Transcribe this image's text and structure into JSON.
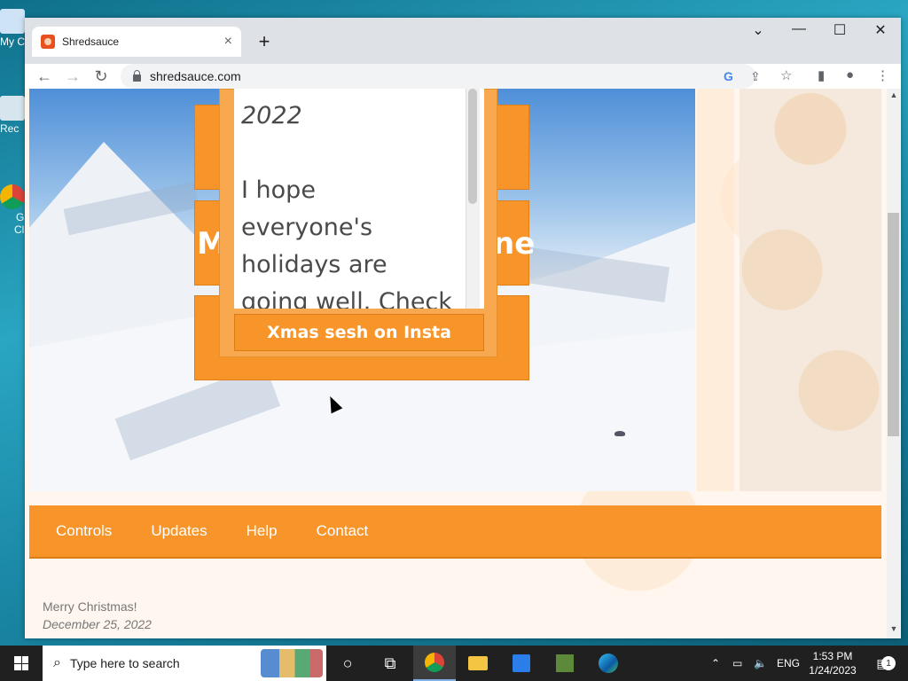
{
  "desktop": {
    "icons": [
      {
        "label": "My C"
      },
      {
        "label": "Rec"
      },
      {
        "label": "G"
      },
      {
        "label": "Cl"
      }
    ]
  },
  "browser": {
    "tab": {
      "title": "Shredsauce",
      "close": "×"
    },
    "new_tab": "+",
    "window_controls": {
      "chevron": "⌄",
      "minimize": "—",
      "maximize": "☐",
      "close": "✕"
    },
    "nav": {
      "back": "←",
      "forward": "→",
      "reload": "↻"
    },
    "url": "shredsauce.com",
    "omni_icons": {
      "google": "G",
      "share": "⇪",
      "star": "☆"
    },
    "toolbar_icons": {
      "sidepanel": "▮",
      "profile": "●",
      "menu": "⋮"
    }
  },
  "page": {
    "left_block_text": "M",
    "right_block_text": "ne",
    "popup": {
      "lines": [
        "2022",
        "",
        "I hope",
        "everyone's",
        "holidays are",
        "going well. Check"
      ],
      "button": "Xmas sesh on Insta"
    },
    "nav_links": [
      "Controls",
      "Updates",
      "Help",
      "Contact"
    ],
    "post": {
      "title": "Merry Christmas!",
      "date": "December 25, 2022"
    },
    "scroll_up": "▲",
    "scroll_down": "▼"
  },
  "taskbar": {
    "search_placeholder": "Type here to search",
    "tray": {
      "language": "ENG",
      "time": "1:53 PM",
      "date": "1/24/2023",
      "notifications": "1"
    },
    "apps": [
      "cortana",
      "task-view",
      "chrome",
      "file-explorer",
      "store",
      "minecraft",
      "edge"
    ]
  },
  "colors": {
    "accent": "#f7952a",
    "accent_dark": "#d97d17",
    "taskbar": "#202020"
  }
}
